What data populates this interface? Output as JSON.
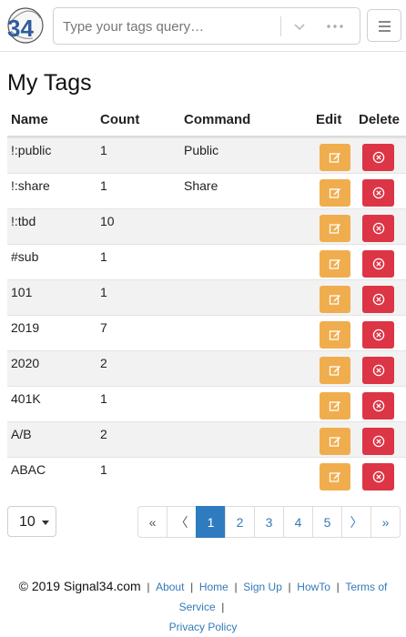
{
  "header": {
    "logo_text": "34",
    "search": {
      "placeholder": "Type your tags query…",
      "value": ""
    }
  },
  "page": {
    "title": "My Tags"
  },
  "table": {
    "columns": [
      "Name",
      "Count",
      "Command",
      "Edit",
      "Delete"
    ],
    "rows": [
      {
        "name": "!:public",
        "count": "1",
        "command": "Public"
      },
      {
        "name": "!:share",
        "count": "1",
        "command": "Share"
      },
      {
        "name": "!:tbd",
        "count": "10",
        "command": ""
      },
      {
        "name": "#sub",
        "count": "1",
        "command": ""
      },
      {
        "name": "101",
        "count": "1",
        "command": ""
      },
      {
        "name": "2019",
        "count": "7",
        "command": ""
      },
      {
        "name": "2020",
        "count": "2",
        "command": ""
      },
      {
        "name": "401K",
        "count": "1",
        "command": ""
      },
      {
        "name": "A/B",
        "count": "2",
        "command": ""
      },
      {
        "name": "ABAC",
        "count": "1",
        "command": ""
      }
    ]
  },
  "pagination": {
    "per_page": "10",
    "first": "«",
    "prev": "〈",
    "pages": [
      "1",
      "2",
      "3",
      "4",
      "5"
    ],
    "current": "1",
    "next": "〉",
    "last": "»"
  },
  "footer": {
    "copyright": "© 2019 Signal34.com",
    "links": [
      "About",
      "Home",
      "Sign Up",
      "HowTo",
      "Terms of Service",
      "Privacy Policy"
    ]
  },
  "colors": {
    "edit": "#f0ad4e",
    "delete": "#dc3545",
    "active_page": "#2f7bbf",
    "link": "#337ab7"
  }
}
